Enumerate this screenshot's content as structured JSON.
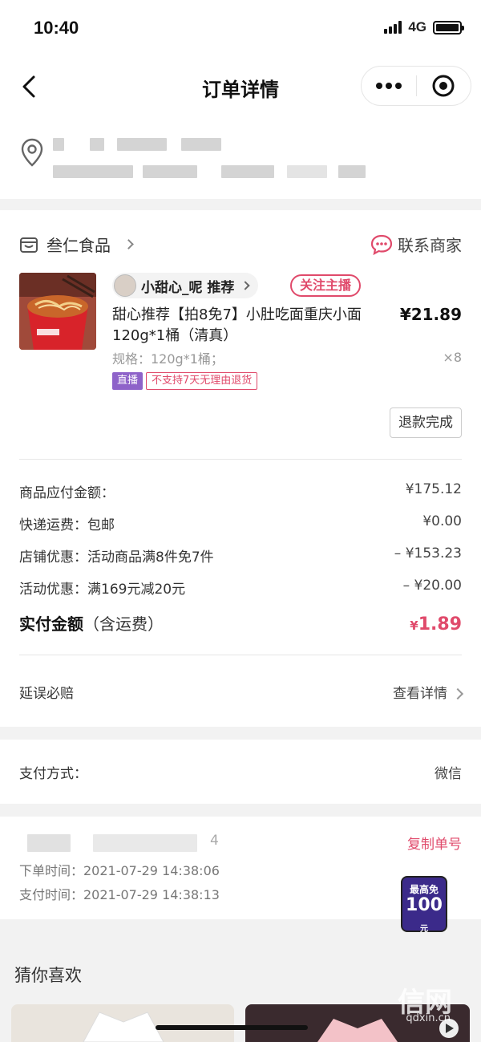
{
  "status": {
    "time": "10:40",
    "network": "4G"
  },
  "nav": {
    "title": "订单详情"
  },
  "shop": {
    "name": "叁仁食品",
    "contact_label": "联系商家"
  },
  "product": {
    "streamer": "小甜心_呢 推荐",
    "follow_label": "关注主播",
    "name": "甜心推荐【拍8免7】小肚吃面重庆小面120g*1桶（清真）",
    "price": "¥21.89",
    "spec": "规格：120g*1桶；",
    "qty": "×8",
    "tag_live": "直播",
    "tag_return": "不支持7天无理由退货",
    "refund_label": "退款完成"
  },
  "fees": [
    {
      "label": "商品应付金额：",
      "value": "¥175.12"
    },
    {
      "label": "快递运费：包邮",
      "value": "¥0.00"
    },
    {
      "label": "店铺优惠：活动商品满8件免7件",
      "value": "– ¥153.23"
    },
    {
      "label": "活动优惠：满169元减20元",
      "value": "– ¥20.00"
    }
  ],
  "total": {
    "label": "实付金额",
    "sub": "（含运费）",
    "currency": "¥",
    "amount": "1.89"
  },
  "delay": {
    "label": "延误必赔",
    "link": "查看详情"
  },
  "payment": {
    "label": "支付方式：",
    "value": "微信"
  },
  "order": {
    "id_tail": "4",
    "copy_label": "复制单号",
    "order_time": "下单时间：2021-07-29 14:38:06",
    "pay_time": "支付时间：2021-07-29 14:38:13"
  },
  "badge": {
    "top": "最高免",
    "num": "100",
    "unit": "元"
  },
  "recommend": {
    "title": "猜你喜欢"
  },
  "watermark": {
    "text": "信网",
    "url": "qdxin.cn"
  },
  "colors": {
    "accent": "#e04a6b",
    "live_tag": "#8e63c9"
  }
}
